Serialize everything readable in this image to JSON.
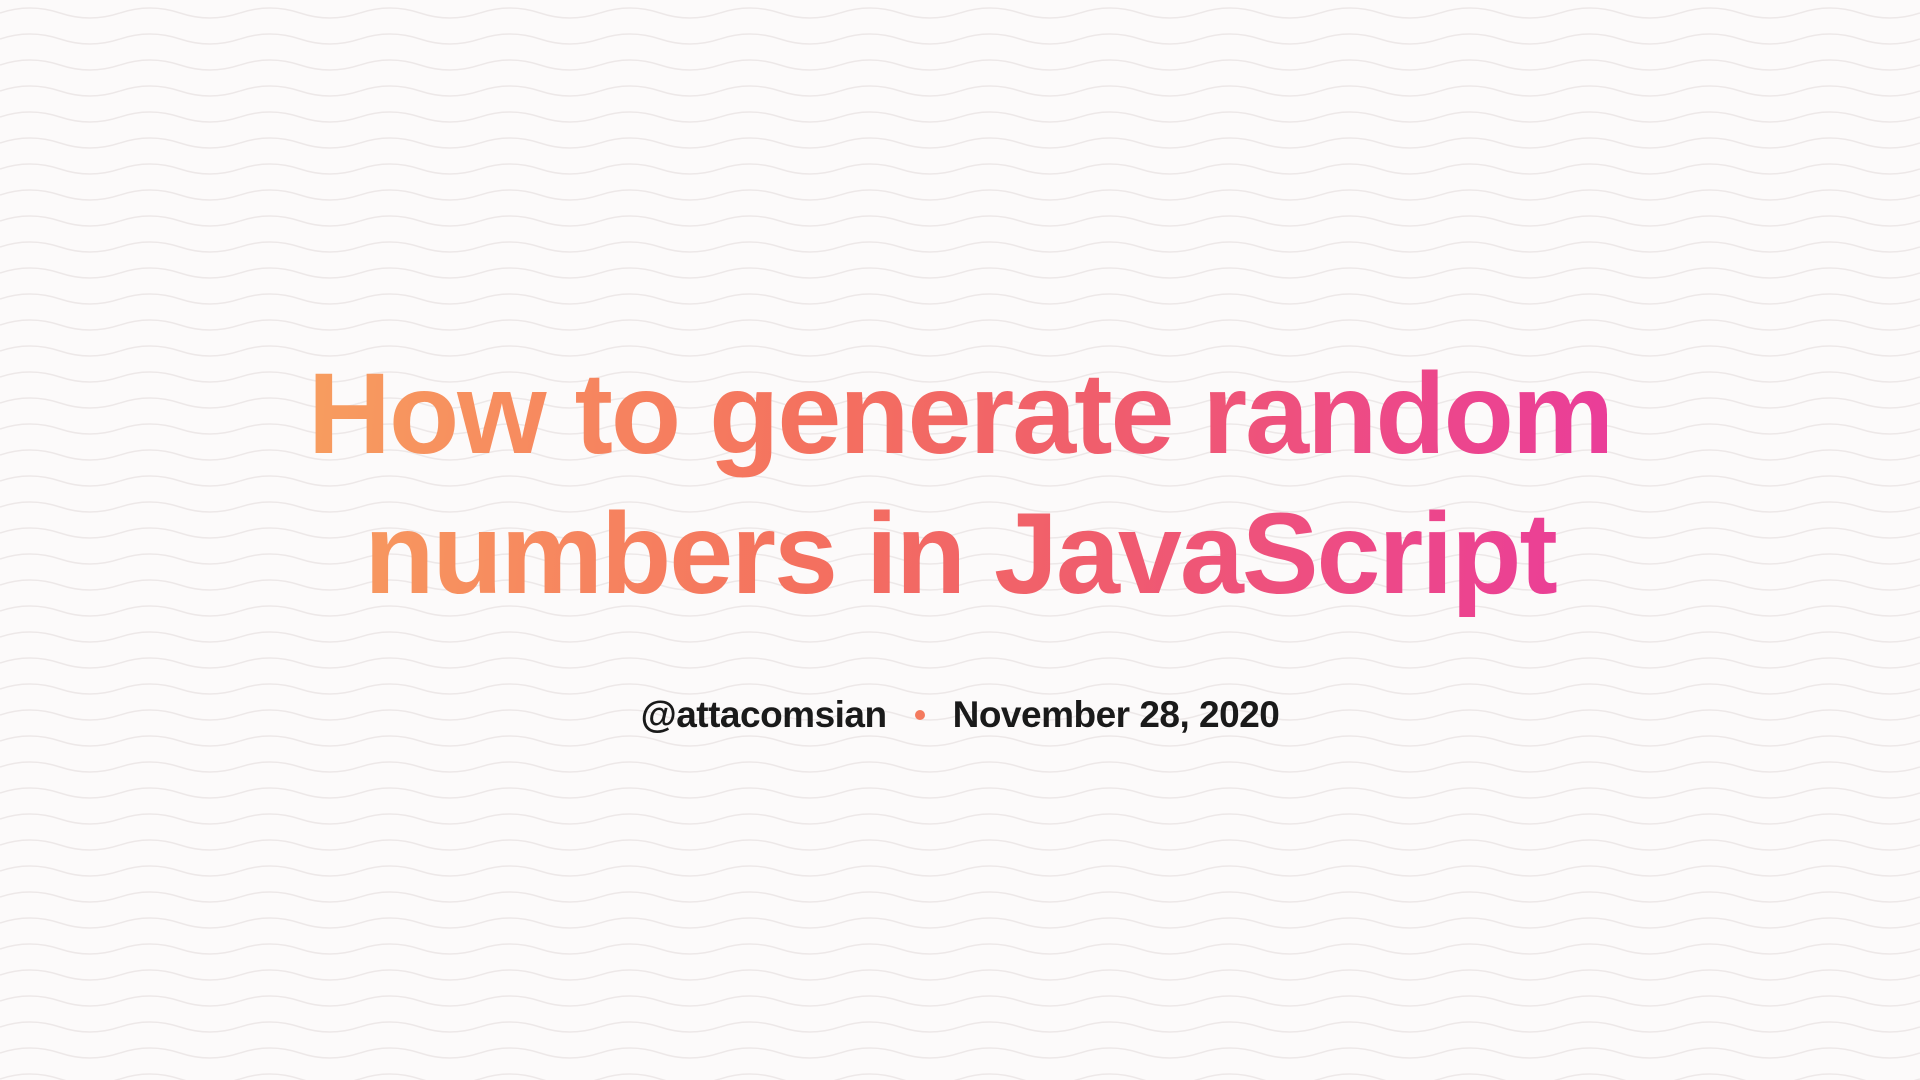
{
  "title": "How to generate random numbers in JavaScript",
  "author": "@attacomsian",
  "date": "November 28, 2020"
}
